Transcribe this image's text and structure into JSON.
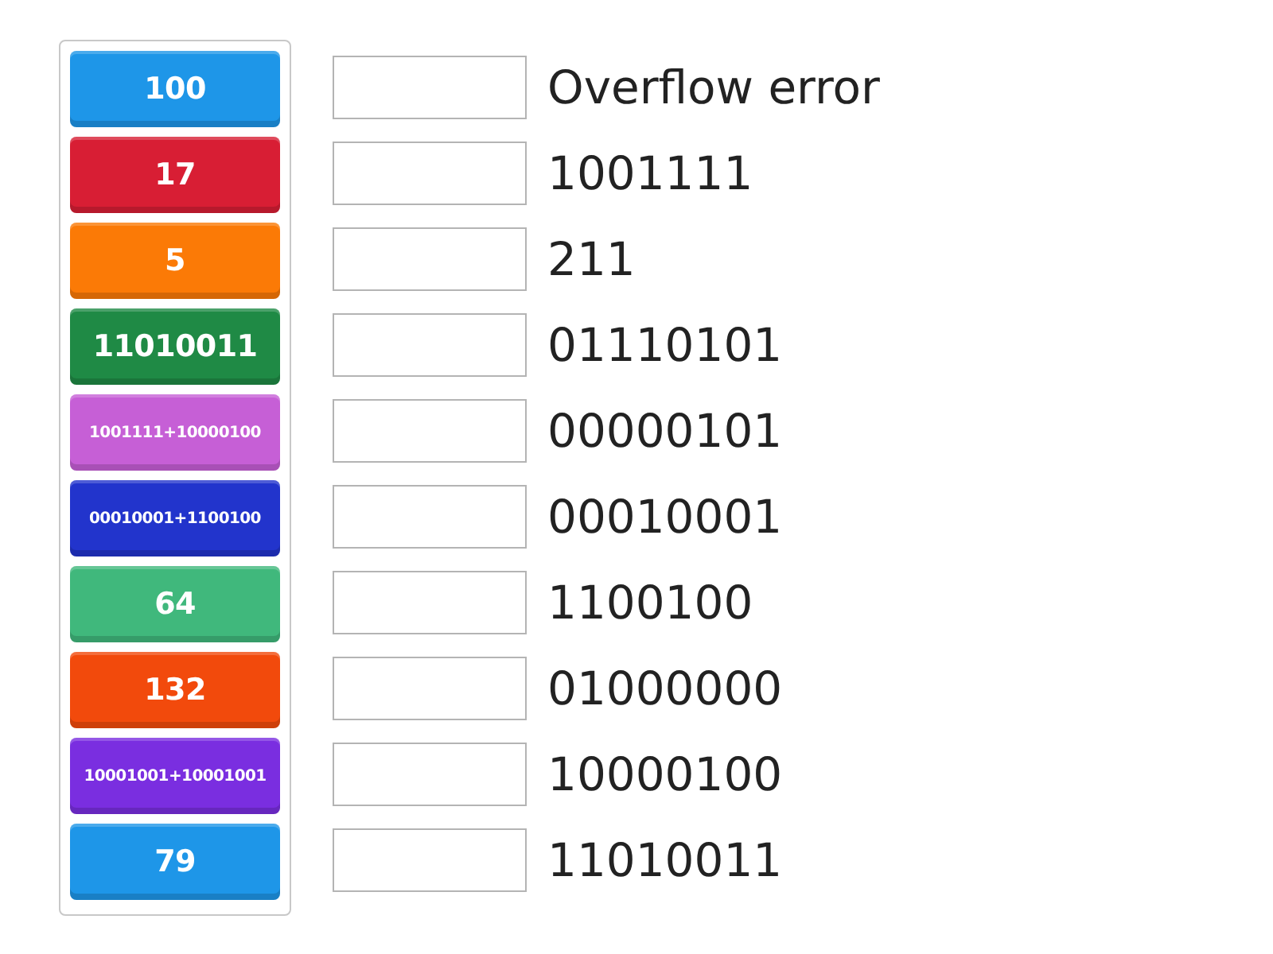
{
  "tiles": [
    {
      "label": "100",
      "color": "#1e96e8"
    },
    {
      "label": "17",
      "color": "#d81e34"
    },
    {
      "label": "5",
      "color": "#fb7a06"
    },
    {
      "label": "11010011",
      "color": "#1f8a45"
    },
    {
      "label": "1001111+10000100",
      "color": "#c65fd6"
    },
    {
      "label": "00010001+1100100",
      "color": "#2234cc"
    },
    {
      "label": "64",
      "color": "#40b87c"
    },
    {
      "label": "132",
      "color": "#f24a0c"
    },
    {
      "label": "10001001+10001001",
      "color": "#7a2ee0"
    },
    {
      "label": "79",
      "color": "#1e96e8"
    }
  ],
  "targets": [
    {
      "label": "Overflow error"
    },
    {
      "label": "1001111"
    },
    {
      "label": "211"
    },
    {
      "label": "01110101"
    },
    {
      "label": "00000101"
    },
    {
      "label": "00010001"
    },
    {
      "label": "1100100"
    },
    {
      "label": "01000000"
    },
    {
      "label": "10000100"
    },
    {
      "label": "11010011"
    }
  ]
}
